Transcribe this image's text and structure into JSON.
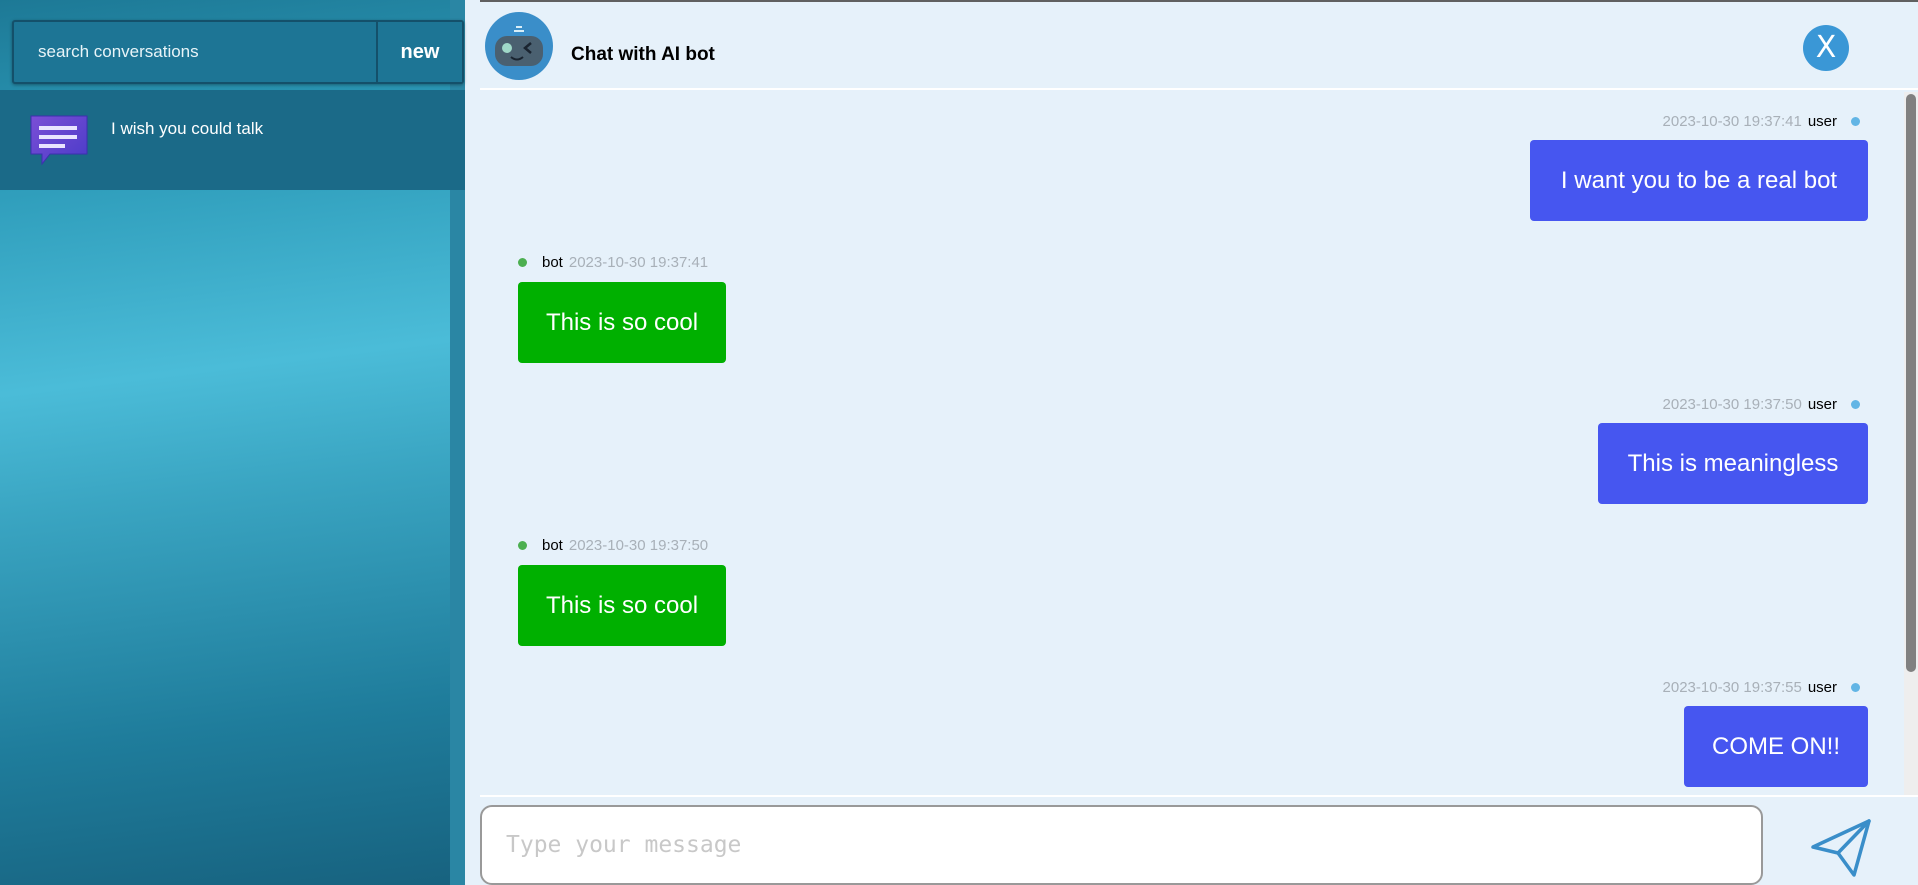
{
  "sidebar": {
    "search_placeholder": "search conversations",
    "new_label": "new",
    "conversations": [
      {
        "title": "I wish you could talk",
        "icon": "chat-bubble-icon"
      }
    ]
  },
  "header": {
    "title": "Chat with AI bot",
    "avatar_icon": "robot-avatar-icon",
    "close_label": "X"
  },
  "messages": [
    {
      "sender": "user",
      "timestamp": "2023-10-30 19:37:41",
      "text": "I want you to be a real bot"
    },
    {
      "sender": "bot",
      "timestamp": "2023-10-30 19:37:41",
      "text": "This is so cool"
    },
    {
      "sender": "user",
      "timestamp": "2023-10-30 19:37:50",
      "text": "This is meaningless"
    },
    {
      "sender": "bot",
      "timestamp": "2023-10-30 19:37:50",
      "text": "This is so cool"
    },
    {
      "sender": "user",
      "timestamp": "2023-10-30 19:37:55",
      "text": "COME ON!!"
    }
  ],
  "input": {
    "placeholder": "Type your message",
    "value": "",
    "send_icon": "send-icon"
  },
  "colors": {
    "user_bubble": "#4656f0",
    "bot_bubble": "#00b000",
    "user_dot": "#62b5e5",
    "bot_dot": "#4caf50",
    "close_button": "#3a97d6"
  }
}
